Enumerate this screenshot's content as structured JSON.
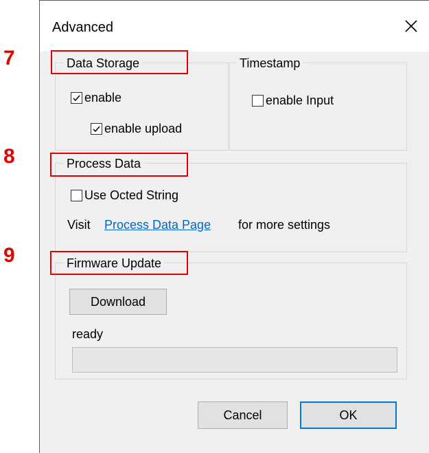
{
  "dialog": {
    "title": "Advanced"
  },
  "markers": [
    "7",
    "8",
    "9"
  ],
  "data_storage": {
    "legend": "Data Storage",
    "enable": {
      "label": "enable",
      "checked": true
    },
    "enable_upload": {
      "label": "enable upload",
      "checked": true
    }
  },
  "timestamp": {
    "legend": "Timestamp",
    "enable_input": {
      "label": "enable Input",
      "checked": false
    }
  },
  "process_data": {
    "legend": "Process Data",
    "use_octed_string": {
      "label": "Use Octed String",
      "checked": false
    },
    "visit_prefix": "Visit",
    "link_text": "Process Data Page",
    "visit_suffix": "for more settings"
  },
  "firmware_update": {
    "legend": "Firmware Update",
    "download_label": "Download",
    "status": "ready",
    "progress": 0
  },
  "footer": {
    "cancel_label": "Cancel",
    "ok_label": "OK"
  },
  "colors": {
    "accent": "#0078d7",
    "marker": "#e00000",
    "link": "#0066cc"
  }
}
